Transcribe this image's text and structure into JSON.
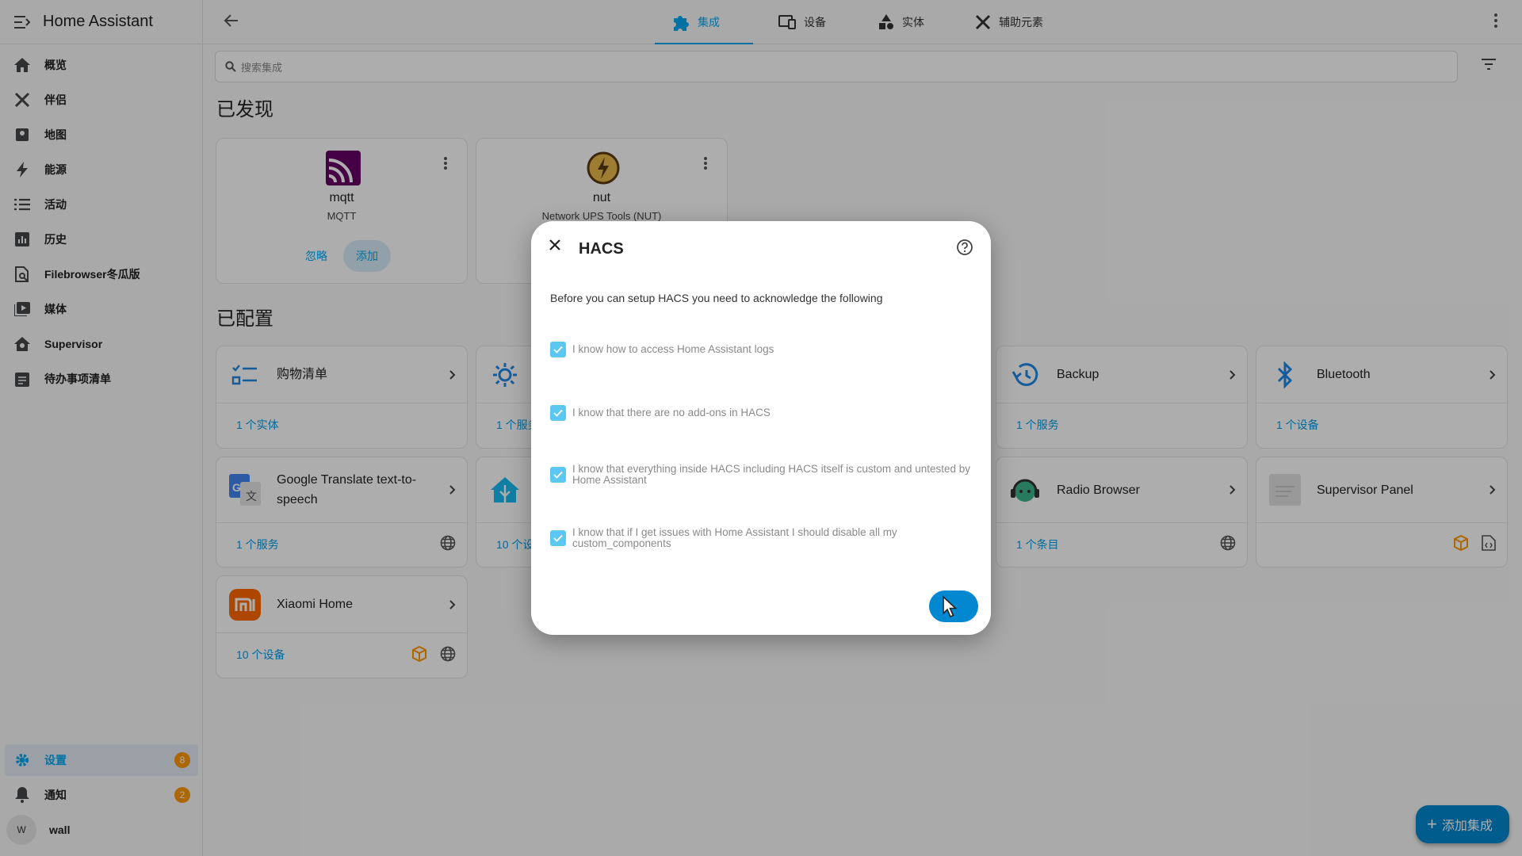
{
  "app_title": "Home Assistant",
  "sidebar": {
    "items": [
      {
        "label": "概览",
        "icon": "home-icon"
      },
      {
        "label": "伴侣",
        "icon": "tools-icon"
      },
      {
        "label": "地图",
        "icon": "map-icon"
      },
      {
        "label": "能源",
        "icon": "energy-icon"
      },
      {
        "label": "活动",
        "icon": "list-icon"
      },
      {
        "label": "历史",
        "icon": "chart-icon"
      },
      {
        "label": "Filebrowser冬瓜版",
        "icon": "file-search-icon"
      },
      {
        "label": "媒体",
        "icon": "media-icon"
      },
      {
        "label": "Supervisor",
        "icon": "supervisor-icon"
      },
      {
        "label": "待办事项清单",
        "icon": "todo-icon"
      }
    ],
    "settings": {
      "label": "设置",
      "badge": "8"
    },
    "notifications": {
      "label": "通知",
      "badge": "2"
    },
    "user": {
      "avatar": "W",
      "name": "wall"
    }
  },
  "tabs": [
    {
      "label": "集成",
      "active": true
    },
    {
      "label": "设备"
    },
    {
      "label": "实体"
    },
    {
      "label": "辅助元素"
    }
  ],
  "search": {
    "placeholder": "搜索集成"
  },
  "discovered": {
    "title": "已发现",
    "cards": [
      {
        "name": "mqtt",
        "subtitle": "MQTT",
        "ignore": "忽略",
        "add": "添加"
      },
      {
        "name": "nut",
        "subtitle": "Network UPS Tools (NUT)"
      }
    ]
  },
  "configured": {
    "title": "已配置",
    "cards": [
      {
        "name": "购物清单",
        "count": "1 个实体"
      },
      {
        "name": "",
        "count": "1 个服务"
      },
      {
        "name": "Backup",
        "count": "1 个服务"
      },
      {
        "name": "Bluetooth",
        "count": "1 个设备"
      },
      {
        "name": "Google Translate text-to-speech",
        "count": "1 个服务"
      },
      {
        "name": "",
        "count": "10 个设备"
      },
      {
        "name": "Radio Browser",
        "count": "1 个条目"
      },
      {
        "name": "Supervisor Panel",
        "count": ""
      },
      {
        "name": "Xiaomi Home",
        "count": "10 个设备"
      }
    ]
  },
  "dialog": {
    "title": "HACS",
    "intro": "Before you can setup HACS you need to acknowledge the following",
    "acks": [
      "I know how to access Home Assistant logs",
      "I know that there are no add-ons in HACS",
      "I know that everything inside HACS including HACS itself is custom and untested by Home Assistant",
      "I know that if I get issues with Home Assistant I should disable all my custom_components"
    ]
  },
  "fab": {
    "label": "添加集成"
  },
  "colors": {
    "accent": "#03a9f4",
    "badge": "#ff9800",
    "primary_button": "#0288d1"
  }
}
